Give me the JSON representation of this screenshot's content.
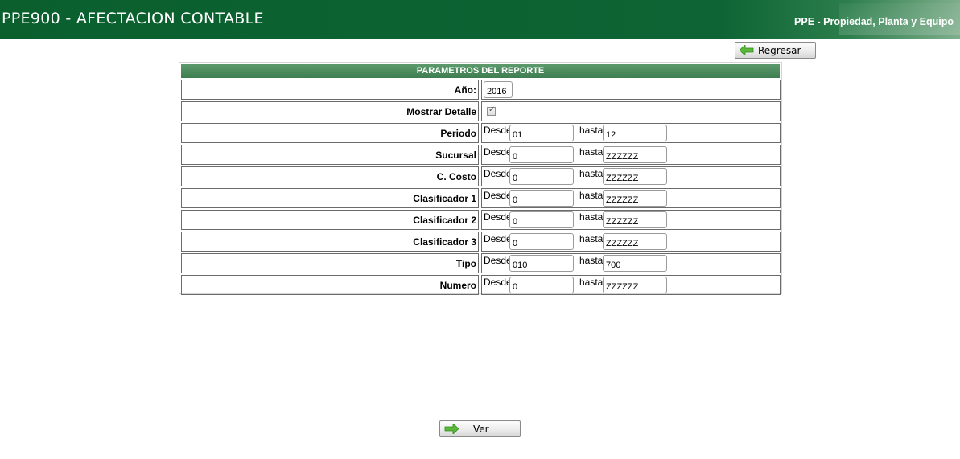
{
  "header": {
    "title": "PPE900 - AFECTACION CONTABLE",
    "subtitle": "PPE - Propiedad, Planta y Equipo"
  },
  "buttons": {
    "regresar": "Regresar",
    "ver": "Ver"
  },
  "params": {
    "title": "PARAMETROS DEL REPORTE",
    "anio_label": "Año:",
    "anio_value": "2016",
    "mostrar_detalle_label": "Mostrar Detalle",
    "mostrar_detalle_checked": true,
    "desde_label": "Desde",
    "hasta_label": "hasta",
    "ranges": [
      {
        "label": "Periodo",
        "desde": "01",
        "hasta": "12"
      },
      {
        "label": "Sucursal",
        "desde": "0",
        "hasta": "ZZZZZZ"
      },
      {
        "label": "C. Costo",
        "desde": "0",
        "hasta": "ZZZZZZ"
      },
      {
        "label": "Clasificador 1",
        "desde": "0",
        "hasta": "ZZZZZZ"
      },
      {
        "label": "Clasificador 2",
        "desde": "0",
        "hasta": "ZZZZZZ"
      },
      {
        "label": "Clasificador 3",
        "desde": "0",
        "hasta": "ZZZZZZ"
      },
      {
        "label": "Tipo",
        "desde": "010",
        "hasta": "700"
      },
      {
        "label": "Numero",
        "desde": "0",
        "hasta": "ZZZZZZ"
      }
    ]
  },
  "colors": {
    "header_green": "#0e6232",
    "table_header_green": "#3e7d50",
    "arrow_green": "#5cb83a"
  },
  "icons": {
    "back_arrow": "arrow-left-icon",
    "go_arrow": "arrow-right-icon"
  }
}
